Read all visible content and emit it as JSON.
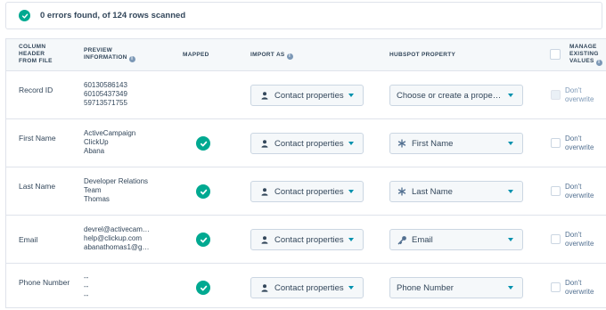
{
  "banner": {
    "text": "0 errors found, of 124 rows scanned",
    "icon": "success-check-icon"
  },
  "headers": {
    "column_header_l1": "COLUMN",
    "column_header_l2": "HEADER",
    "column_header_l3": "FROM FILE",
    "preview_l1": "PREVIEW",
    "preview_l2": "INFORMATION",
    "mapped": "MAPPED",
    "import_as": "IMPORT AS",
    "hubspot_property": "HUBSPOT PROPERTY",
    "manage_l1": "MANAGE",
    "manage_l2": "EXISTING",
    "manage_l3": "VALUES"
  },
  "colors": {
    "accent_green": "#00a991",
    "caret_blue": "#0091ae",
    "text_dark": "#33475b"
  },
  "rows": [
    {
      "header": "Record ID",
      "preview": [
        "60130586143",
        "60105437349",
        "59713571755"
      ],
      "mapped": false,
      "import_as": "Contact properties",
      "property": "Choose or create a prope…",
      "property_icon": "",
      "overwrite_l1": "Don't",
      "overwrite_l2": "overwrite",
      "overwrite_disabled": true
    },
    {
      "header": "First Name",
      "preview": [
        "ActiveCampaign",
        "ClickUp",
        "Abana"
      ],
      "mapped": true,
      "import_as": "Contact properties",
      "property": "First Name",
      "property_icon": "asterisk-icon",
      "overwrite_l1": "Don't",
      "overwrite_l2": "overwrite",
      "overwrite_disabled": false
    },
    {
      "header": "Last Name",
      "preview": [
        "Developer Relations",
        "Team",
        "Thomas"
      ],
      "mapped": true,
      "import_as": "Contact properties",
      "property": "Last Name",
      "property_icon": "asterisk-icon",
      "overwrite_l1": "Don't",
      "overwrite_l2": "overwrite",
      "overwrite_disabled": false
    },
    {
      "header": "Email",
      "preview": [
        "devrel@activecam…",
        "help@clickup.com",
        "abanathomas1@g…"
      ],
      "mapped": true,
      "import_as": "Contact properties",
      "property": "Email",
      "property_icon": "key-icon",
      "overwrite_l1": "Don't",
      "overwrite_l2": "overwrite",
      "overwrite_disabled": false
    },
    {
      "header": "Phone Number",
      "preview": [
        "--",
        "--",
        "--"
      ],
      "mapped": true,
      "import_as": "Contact properties",
      "property": "Phone Number",
      "property_icon": "",
      "overwrite_l1": "Don't",
      "overwrite_l2": "overwrite",
      "overwrite_disabled": false
    }
  ]
}
